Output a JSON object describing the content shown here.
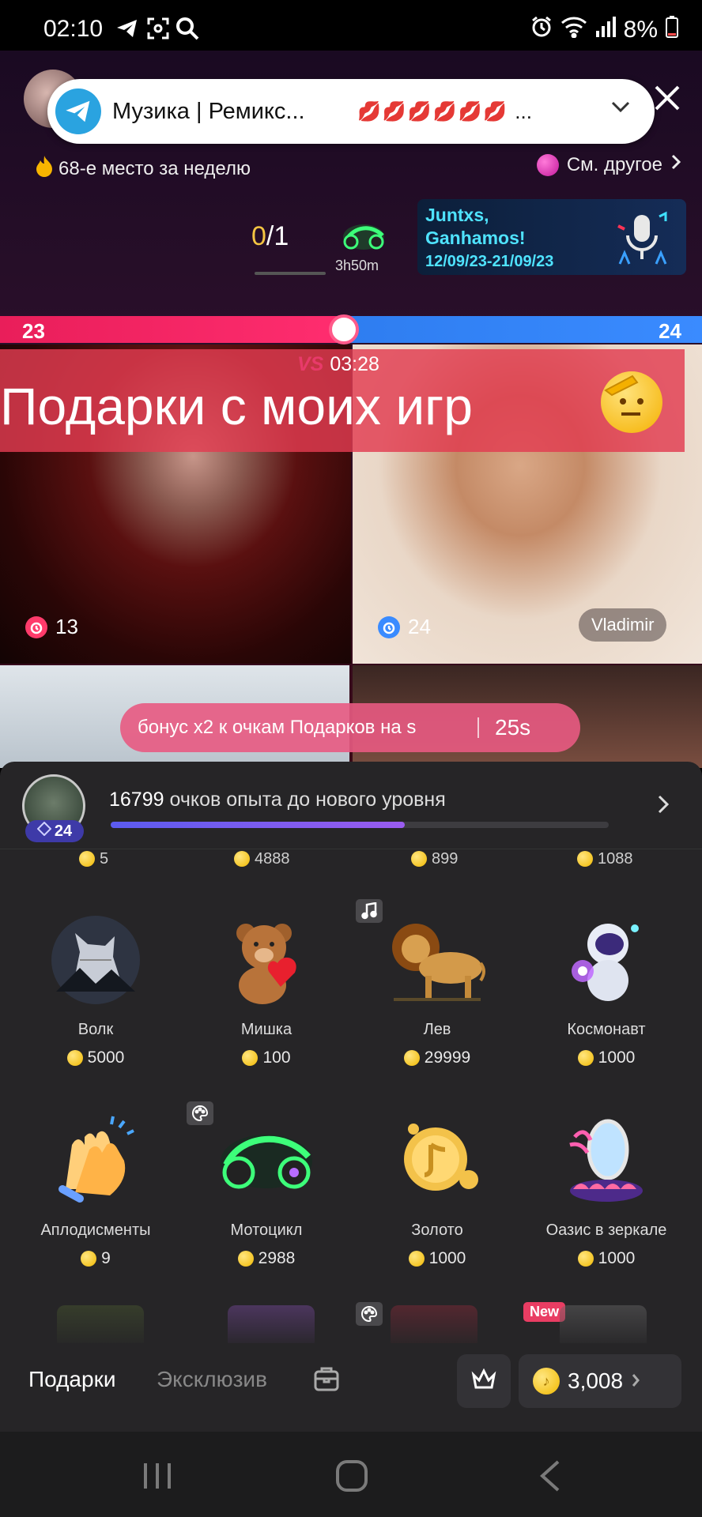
{
  "status_bar": {
    "time": "02:10",
    "battery": "8%",
    "icons": [
      "telegram-icon",
      "screenshot-icon",
      "search-icon",
      "alarm-icon",
      "wifi-icon",
      "signal-icon",
      "battery-icon"
    ]
  },
  "notification": {
    "app_icon": "telegram-icon",
    "title": "Музика | Ремикс...",
    "emoji_row": "💋💋💋💋💋💋",
    "ellipsis": "...",
    "expand_icon": "chevron-down-icon"
  },
  "live": {
    "rank_text": "68-е место за неделю",
    "see_other": "См. другое",
    "task_progress": {
      "done": "0",
      "total": "/1"
    },
    "gift_timer": "3h50m",
    "event": {
      "title_line1": "Juntxs,",
      "title_line2": "Ganhamos!",
      "dates": "12/09/23-21/09/23"
    },
    "pk": {
      "left_score": "23",
      "right_score": "24",
      "left_share": 0.49,
      "timer": "03:28",
      "vs": "VS"
    },
    "banner": "Подарки с моих игр",
    "tiles": [
      {
        "likes": "13",
        "color": "#ff3b6b"
      },
      {
        "likes": "24",
        "name": "Vladimir",
        "color": "#3a8bff"
      }
    ],
    "bonus": {
      "text": "бонус x2 к очкам Подарков на s",
      "timer": "25s"
    }
  },
  "panel": {
    "level": "24",
    "xp_points": "16799",
    "xp_text": "очков опыта до нового уровня",
    "xp_progress": 0.59,
    "cut_prices": [
      "5",
      "4888",
      "899",
      "1088"
    ],
    "gifts": [
      {
        "name": "Волк",
        "price": "5000",
        "icon": "wolf-icon"
      },
      {
        "name": "Мишка",
        "price": "100",
        "icon": "teddy-bear-icon"
      },
      {
        "name": "Лев",
        "price": "29999",
        "icon": "lion-icon"
      },
      {
        "name": "Космонавт",
        "price": "1000",
        "icon": "astronaut-icon"
      },
      {
        "name": "Аплодисменты",
        "price": "9",
        "icon": "clapping-hands-icon"
      },
      {
        "name": "Мотоцикл",
        "price": "2988",
        "icon": "motorcycle-icon"
      },
      {
        "name": "Золото",
        "price": "1000",
        "icon": "gold-coin-icon"
      },
      {
        "name": "Оазис в зеркале",
        "price": "1000",
        "icon": "mirror-oasis-icon"
      }
    ],
    "new_badge": "New",
    "tabs": {
      "gifts": "Подарки",
      "exclusive": "Эксклюзив"
    },
    "balance": "3,008"
  }
}
